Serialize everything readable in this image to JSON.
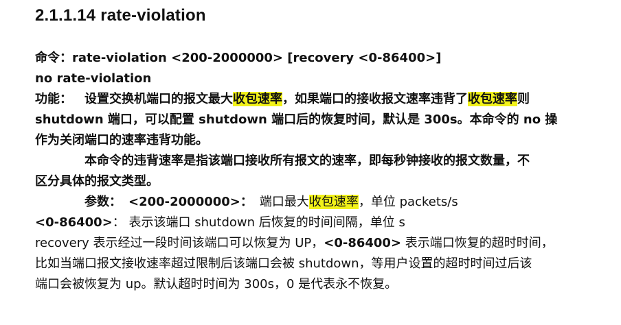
{
  "doc": {
    "heading": "2.1.1.14 rate-violation",
    "cmd_label": "命令：",
    "cmd_syntax": "rate-violation <200-2000000> [recovery <0-86400>]",
    "no_cmd": "no rate-violation",
    "func": {
      "label": "功能：",
      "text1": "设置交换机端口的报文最大",
      "hl1": "收包速率",
      "text2": "，如果端口的接收报文速率违背了",
      "hl2": "收包速率",
      "text3": "则",
      "line2": "shutdown 端口，可以配置 shutdown 端口后的恢复时间，默认是 300s。本命令的 no 操",
      "line3": "作为关闭端口的速率违背功能。"
    },
    "desc": {
      "line1": "本命令的违背速率是指该端口接收所有报文的速率，即每秒钟接收的报文数量，不",
      "line2": "区分具体的报文类型。"
    },
    "params": {
      "label": "参数：",
      "p1_name": "<200-2000000>：",
      "p1_text1": "端口最大",
      "p1_hl": "收包速率",
      "p1_text2": "，单位 packets/s",
      "p2_name": "<0-86400>",
      "p2_text": "：  表示该端口 shutdown 后恢复的时间间隔，单位 s",
      "p3_text1": "recovery  表示经过一段时间该端口可以恢复为 UP，",
      "p3_bold": "<0-86400>",
      "p3_text2": " 表示端口恢复的超时时间，",
      "p3_line2": "比如当端口报文接收速率超过限制后该端口会被 shutdown，等用户设置的超时时间过后该",
      "p3_line3": "端口会被恢复为 up。默认超时时间为 300s，0 是代表永不恢复。"
    }
  }
}
